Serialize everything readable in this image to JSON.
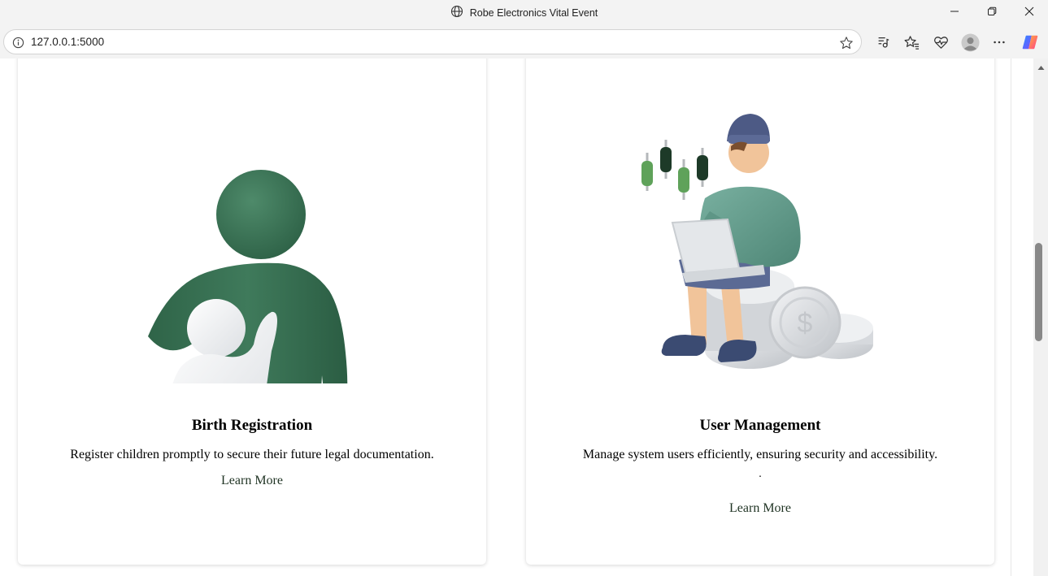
{
  "window": {
    "title": "Robe Electronics Vital Event",
    "globe_icon": "globe-icon",
    "controls": [
      "minimize-icon",
      "restore-icon",
      "close-icon"
    ]
  },
  "browser": {
    "url": "127.0.0.1:5000",
    "toolbar_icons": [
      "site-info-icon",
      "favorite-star-icon",
      "media-control-icon",
      "favorites-icon",
      "browser-essentials-icon",
      "profile-avatar-icon",
      "more-menu-icon",
      "copilot-icon"
    ]
  },
  "cards": [
    {
      "title": "Birth Registration",
      "description": "Register children promptly to secure their future legal documentation.",
      "link": "Learn More",
      "illustration": "parent-child-illustration"
    },
    {
      "title": "User Management",
      "description": "Manage system users efficiently, ensuring security and accessibility.",
      "extra_text": ".",
      "link": "Learn More",
      "illustration": "person-laptop-coins-illustration"
    }
  ],
  "colors": {
    "brand_green": "#3c7256",
    "hoodie_teal": "#6aa191",
    "link_text": "#1f3323",
    "chrome_bg": "#f3f3f3"
  }
}
